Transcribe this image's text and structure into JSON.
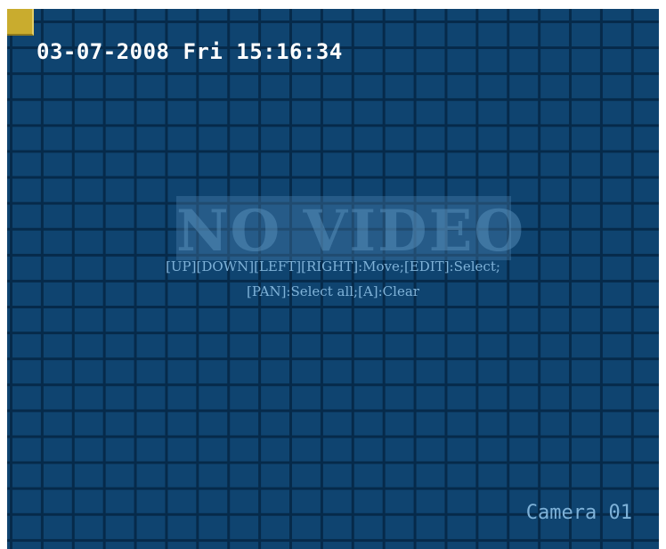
{
  "osd": {
    "datetime": "03-07-2008 Fri 15:16:34",
    "no_video": "NO VIDEO",
    "camera_label": "Camera 01"
  },
  "hints": {
    "line1": "[UP][DOWN][LEFT][RIGHT]:Move;[EDIT]:Select;",
    "line2": "[PAN]:Select all;[A]:Clear"
  },
  "colors": {
    "screen_background": "#0f4470",
    "grid_lines": "#062a4a",
    "corner_marker": "#c9ac2e",
    "hint_text": "#7fb2d8",
    "datetime_text": "#ffffff"
  }
}
